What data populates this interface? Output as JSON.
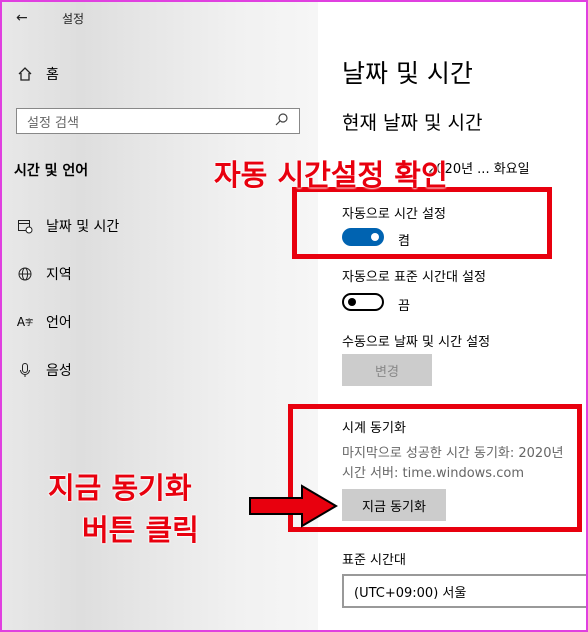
{
  "titlebar": {
    "back_icon": "arrow-left-icon",
    "app_name": "설정"
  },
  "sidebar": {
    "home_label": "홈",
    "search_placeholder": "설정 검색",
    "section_title": "시간 및 언어",
    "items": [
      {
        "label": "날짜 및 시간",
        "icon": "calendar-clock-icon"
      },
      {
        "label": "지역",
        "icon": "globe-icon"
      },
      {
        "label": "언어",
        "icon": "language-icon"
      },
      {
        "label": "음성",
        "icon": "microphone-icon"
      }
    ]
  },
  "main": {
    "page_title": "날짜 및 시간",
    "current_heading": "현재 날짜 및 시간",
    "current_datetime": "2020년 ... 화요일",
    "auto_time": {
      "label": "자동으로 시간 설정",
      "state": "켬",
      "on": true
    },
    "auto_timezone": {
      "label": "자동으로 표준 시간대 설정",
      "state": "끔",
      "on": false
    },
    "manual": {
      "label": "수동으로 날짜 및 시간 설정",
      "button": "변경"
    },
    "sync": {
      "heading": "시계 동기화",
      "last_sync": "마지막으로 성공한 시간 동기화: 2020년",
      "server": "시간 서버: time.windows.com",
      "button": "지금 동기화"
    },
    "timezone": {
      "label": "표준 시간대",
      "value": "(UTC+09:00) 서울"
    }
  },
  "annotations": {
    "top": "자동 시간설정 확인",
    "bottom_line1": "지금 동기화",
    "bottom_line2": "버튼 클릭"
  },
  "colors": {
    "accent": "#0063b1",
    "annotation_red": "#e8000e",
    "frame": "#e040e0"
  }
}
